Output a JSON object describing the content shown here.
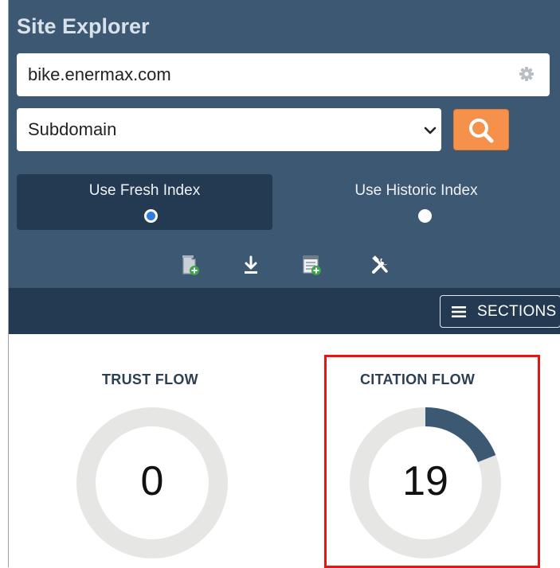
{
  "panel": {
    "title": "Site Explorer",
    "url_value": "bike.enermax.com",
    "scope_value": "Subdomain",
    "index_options": [
      {
        "label": "Use Fresh Index",
        "selected": true
      },
      {
        "label": "Use Historic Index",
        "selected": false
      }
    ],
    "tools": [
      "bin-add-icon",
      "download-icon",
      "report-add-icon",
      "tools-icon"
    ]
  },
  "navbar": {
    "sections_label": "SECTIONS"
  },
  "metrics": {
    "trust_flow": {
      "label": "TRUST FLOW",
      "value": "0"
    },
    "citation_flow": {
      "label": "CITATION FLOW",
      "value": "19"
    }
  },
  "colors": {
    "panel_bg": "#3d5872",
    "navbar_bg": "#243a52",
    "search_button": "#f5914a",
    "gauge_track": "#e6e6e4",
    "gauge_fill": "#3d5872",
    "highlight_border": "#ee1111"
  }
}
